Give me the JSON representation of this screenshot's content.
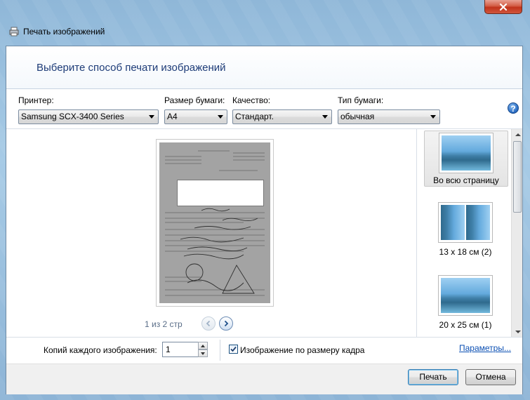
{
  "window": {
    "title": "Печать изображений",
    "header": "Выберите способ печати изображений"
  },
  "options": {
    "printer_label": "Принтер:",
    "printer_value": "Samsung SCX-3400 Series",
    "paper_size_label": "Размер бумаги:",
    "paper_size_value": "A4",
    "quality_label": "Качество:",
    "quality_value": "Стандарт.",
    "paper_type_label": "Тип бумаги:",
    "paper_type_value": "обычная",
    "help": "?"
  },
  "preview": {
    "page_count": "1 из 2 стр"
  },
  "layouts": [
    {
      "label": "Во всю страницу",
      "selected": true
    },
    {
      "label": "13 x 18 см (2)",
      "selected": false
    },
    {
      "label": "20 x 25 см (1)",
      "selected": false
    }
  ],
  "bottom": {
    "copies_label": "Копий каждого изображения:",
    "copies_value": "1",
    "fit_checkbox_label": "Изображение по размеру кадра",
    "fit_checked": true,
    "params_link": "Параметры..."
  },
  "buttons": {
    "print": "Печать",
    "cancel": "Отмена"
  },
  "colors": {
    "header_text": "#1e3c78",
    "link": "#0b4fb3",
    "close_button": "#c1331b"
  }
}
